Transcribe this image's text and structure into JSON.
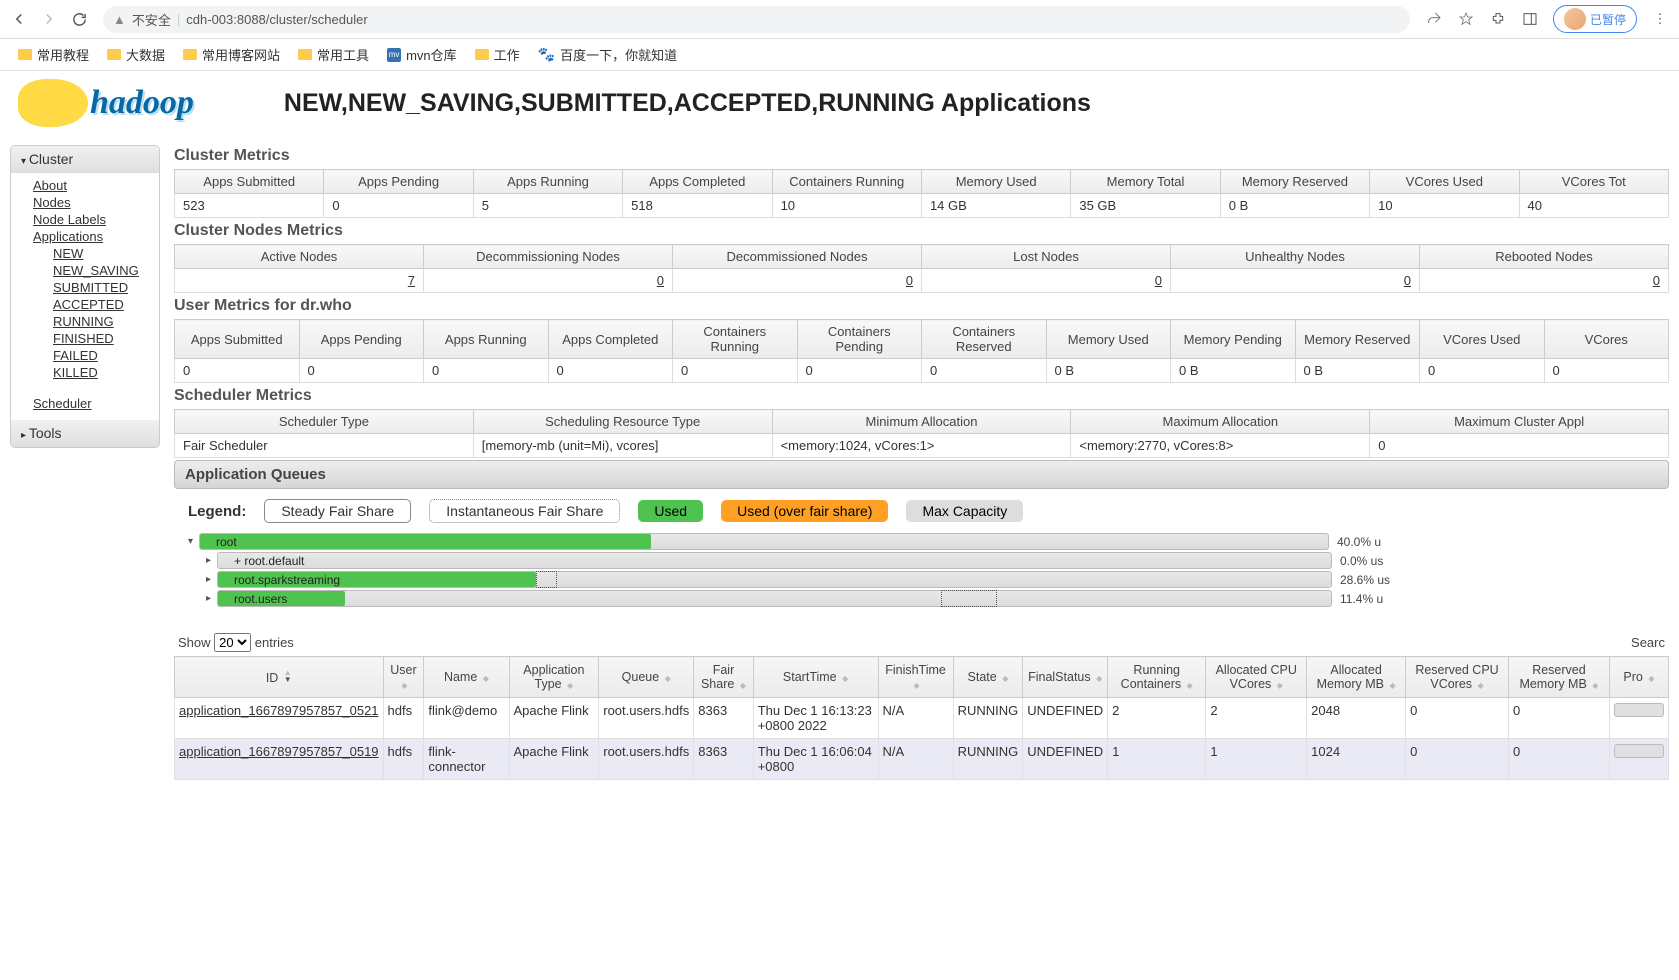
{
  "browser": {
    "url_security": "不安全",
    "url": "cdh-003:8088/cluster/scheduler",
    "profile_text": "已暂停",
    "bookmarks": [
      {
        "icon": "folder",
        "label": "常用教程"
      },
      {
        "icon": "folder",
        "label": "大数据"
      },
      {
        "icon": "folder",
        "label": "常用博客网站"
      },
      {
        "icon": "folder",
        "label": "常用工具"
      },
      {
        "icon": "mvn",
        "label": "mvn仓库"
      },
      {
        "icon": "folder",
        "label": "工作"
      },
      {
        "icon": "paw",
        "label": "百度一下，你就知道"
      }
    ]
  },
  "logo_text": "hadoop",
  "title": "NEW,NEW_SAVING,SUBMITTED,ACCEPTED,RUNNING Applications",
  "sidebar": {
    "cluster_label": "Cluster",
    "tools_label": "Tools",
    "links": [
      "About",
      "Nodes",
      "Node Labels",
      "Applications"
    ],
    "app_states": [
      "NEW",
      "NEW_SAVING",
      "SUBMITTED",
      "ACCEPTED",
      "RUNNING",
      "FINISHED",
      "FAILED",
      "KILLED"
    ],
    "scheduler": "Scheduler"
  },
  "cluster_metrics": {
    "title": "Cluster Metrics",
    "headers": [
      "Apps Submitted",
      "Apps Pending",
      "Apps Running",
      "Apps Completed",
      "Containers Running",
      "Memory Used",
      "Memory Total",
      "Memory Reserved",
      "VCores Used",
      "VCores Tot"
    ],
    "values": [
      "523",
      "0",
      "5",
      "518",
      "10",
      "14 GB",
      "35 GB",
      "0 B",
      "10",
      "40"
    ]
  },
  "node_metrics": {
    "title": "Cluster Nodes Metrics",
    "headers": [
      "Active Nodes",
      "Decommissioning Nodes",
      "Decommissioned Nodes",
      "Lost Nodes",
      "Unhealthy Nodes",
      "Rebooted Nodes"
    ],
    "values": [
      "7",
      "0",
      "0",
      "0",
      "0",
      "0"
    ]
  },
  "user_metrics": {
    "title": "User Metrics for dr.who",
    "headers": [
      "Apps Submitted",
      "Apps Pending",
      "Apps Running",
      "Apps Completed",
      "Containers Running",
      "Containers Pending",
      "Containers Reserved",
      "Memory Used",
      "Memory Pending",
      "Memory Reserved",
      "VCores Used",
      "VCores"
    ],
    "values": [
      "0",
      "0",
      "0",
      "0",
      "0",
      "0",
      "0",
      "0 B",
      "0 B",
      "0 B",
      "0",
      "0"
    ]
  },
  "sched_metrics": {
    "title": "Scheduler Metrics",
    "headers": [
      "Scheduler Type",
      "Scheduling Resource Type",
      "Minimum Allocation",
      "Maximum Allocation",
      "Maximum Cluster Appl"
    ],
    "values": [
      "Fair Scheduler",
      "[memory-mb (unit=Mi), vcores]",
      "<memory:1024, vCores:1>",
      "<memory:2770, vCores:8>",
      "0"
    ]
  },
  "queues": {
    "title": "Application Queues",
    "legend_label": "Legend:",
    "legend": {
      "steady": "Steady Fair Share",
      "inst": "Instantaneous Fair Share",
      "used": "Used",
      "over": "Used (over fair share)",
      "max": "Max Capacity"
    },
    "tree": [
      {
        "indent": 0,
        "toggle": "▾",
        "name": "root",
        "used_pct": 40,
        "bar_pct": 100,
        "inst_start": null,
        "inst_end": null,
        "pct_text": "40.0% u"
      },
      {
        "indent": 1,
        "toggle": "▸",
        "name": "+ root.default",
        "used_pct": 0,
        "bar_pct": 100,
        "pct_text": "0.0% us"
      },
      {
        "indent": 1,
        "toggle": "▸",
        "name": "root.sparkstreaming",
        "used_pct": 28.6,
        "bar_pct": 100,
        "inst_start": 28.6,
        "inst_end": 30.5,
        "pct_text": "28.6% us"
      },
      {
        "indent": 1,
        "toggle": "▸",
        "name": "root.users",
        "used_pct": 11.4,
        "bar_pct": 70,
        "inst_start": 65,
        "inst_end": 70,
        "pct_text": "11.4% u"
      }
    ]
  },
  "apps": {
    "show_label": "Show",
    "entries_label": "entries",
    "search_label": "Searc",
    "options": [
      "20"
    ],
    "headers": [
      "ID",
      "User",
      "Name",
      "Application Type",
      "Queue",
      "Fair Share",
      "StartTime",
      "FinishTime",
      "State",
      "FinalStatus",
      "Running Containers",
      "Allocated CPU VCores",
      "Allocated Memory MB",
      "Reserved CPU VCores",
      "Reserved Memory MB",
      "Pro"
    ],
    "rows": [
      {
        "id": "application_1667897957857_0521",
        "user": "hdfs",
        "name": "flink@demo",
        "type": "Apache Flink",
        "queue": "root.users.hdfs",
        "fairshare": "8363",
        "start": "Thu Dec 1 16:13:23 +0800 2022",
        "finish": "N/A",
        "state": "RUNNING",
        "final": "UNDEFINED",
        "rc": "2",
        "cpu": "2",
        "mem": "2048",
        "rcpu": "0",
        "rmem": "0"
      },
      {
        "id": "application_1667897957857_0519",
        "user": "hdfs",
        "name": "flink-connector",
        "type": "Apache Flink",
        "queue": "root.users.hdfs",
        "fairshare": "8363",
        "start": "Thu Dec 1 16:06:04 +0800",
        "finish": "N/A",
        "state": "RUNNING",
        "final": "UNDEFINED",
        "rc": "1",
        "cpu": "1",
        "mem": "1024",
        "rcpu": "0",
        "rmem": "0"
      }
    ]
  }
}
